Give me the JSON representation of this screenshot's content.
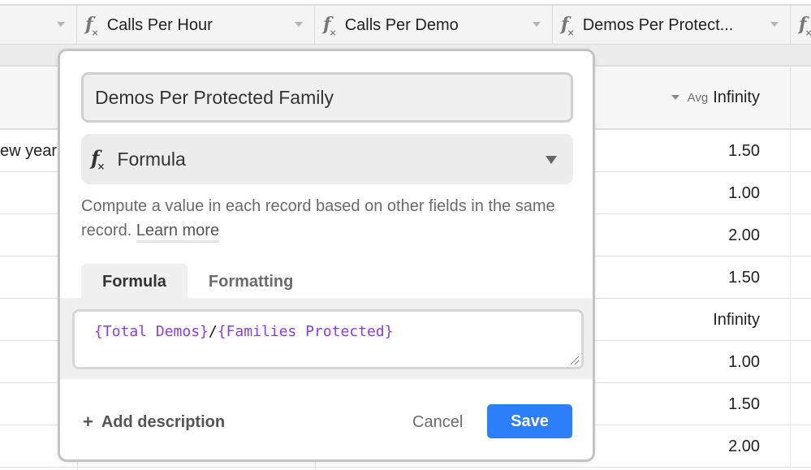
{
  "grid": {
    "columns": [
      {
        "label": "",
        "has_formula_icon": false
      },
      {
        "label": "Calls Per Hour",
        "has_formula_icon": true
      },
      {
        "label": "Calls Per Demo",
        "has_formula_icon": true
      },
      {
        "label": "Demos Per Protect...",
        "has_formula_icon": true
      },
      {
        "label": "",
        "has_formula_icon": true
      }
    ],
    "summary": {
      "agg_label": "Avg",
      "value": "Infinity"
    },
    "rows": [
      {
        "left_text": "ew year",
        "value": "1.50"
      },
      {
        "left_text": "",
        "value": "1.00"
      },
      {
        "left_text": "",
        "value": "2.00"
      },
      {
        "left_text": "",
        "value": "1.50"
      },
      {
        "left_text": "",
        "value": "Infinity"
      },
      {
        "left_text": "",
        "value": "1.00"
      },
      {
        "left_text": "",
        "value": "1.50"
      },
      {
        "left_text": "",
        "value": "2.00"
      }
    ]
  },
  "dialog": {
    "field_name": "Demos Per Protected Family",
    "field_type": "Formula",
    "description": "Compute a value in each record based on other fields in the same record.",
    "learn_more": "Learn more",
    "tabs": [
      {
        "label": "Formula",
        "active": true
      },
      {
        "label": "Formatting",
        "active": false
      }
    ],
    "formula": {
      "ref1": "{Total Demos}",
      "operator": "/",
      "ref2": "{Families Protected}"
    },
    "add_description": "Add description",
    "cancel_label": "Cancel",
    "save_label": "Save",
    "colors": {
      "accent": "#2d7ff9",
      "field_ref": "#8b3ee0"
    }
  }
}
